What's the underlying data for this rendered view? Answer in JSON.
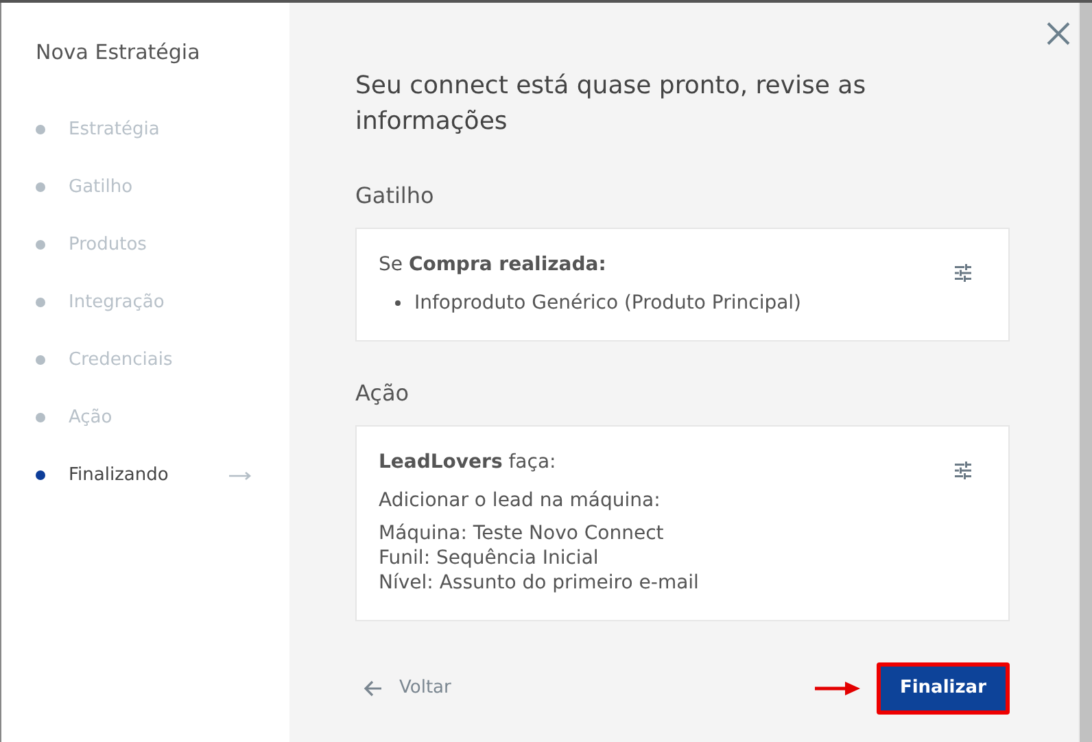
{
  "sidebar": {
    "title": "Nova Estratégia",
    "steps": [
      {
        "label": "Estratégia",
        "selected": false
      },
      {
        "label": "Gatilho",
        "selected": false
      },
      {
        "label": "Produtos",
        "selected": false
      },
      {
        "label": "Integração",
        "selected": false
      },
      {
        "label": "Credenciais",
        "selected": false
      },
      {
        "label": "Ação",
        "selected": false
      },
      {
        "label": "Finalizando",
        "selected": true
      }
    ]
  },
  "main": {
    "heading": "Seu connect está quase pronto, revise as informações",
    "sections": [
      {
        "title": "Gatilho",
        "lead": "Se **Compra realizada:**",
        "bullets": [
          "Infoproduto Genérico (Produto Principal)"
        ]
      },
      {
        "title": "Ação",
        "lead": "**LeadLovers** faça:",
        "subtitle": "Adicionar o lead na máquina:",
        "lines": [
          "Máquina: Teste Novo Connect",
          "Funil: Sequência Inicial",
          "Nível: Assunto do primeiro e-mail"
        ]
      }
    ],
    "back_button": "Voltar",
    "finish_button": {
      "label": "Finalizar",
      "highlighted": true
    }
  }
}
